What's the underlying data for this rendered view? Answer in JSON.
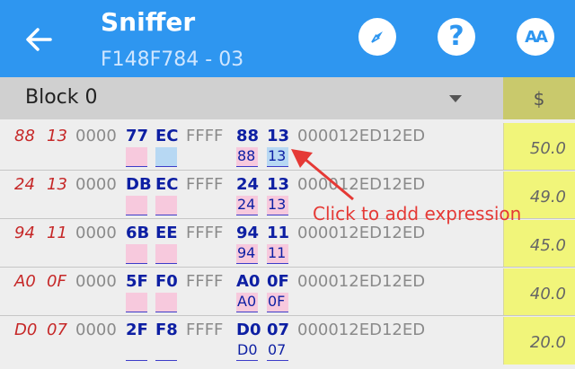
{
  "app": {
    "title": "Sniffer",
    "subtitle": "F148F784 - 03"
  },
  "block": {
    "label": "Block 0",
    "column_header": "$"
  },
  "rows": [
    {
      "raw": [
        "88",
        "13"
      ],
      "zeros": "0000",
      "b1": "77",
      "b2": "EC",
      "ffff": "FFFF",
      "b3": "88",
      "b4": "13",
      "tail": "000012ED12ED",
      "sub3": "88",
      "sub4": "13",
      "price": "50.0"
    },
    {
      "raw": [
        "24",
        "13"
      ],
      "zeros": "0000",
      "b1": "DB",
      "b2": "EC",
      "ffff": "FFFF",
      "b3": "24",
      "b4": "13",
      "tail": "000012ED12ED",
      "sub3": "24",
      "sub4": "13",
      "price": "49.0"
    },
    {
      "raw": [
        "94",
        "11"
      ],
      "zeros": "0000",
      "b1": "6B",
      "b2": "EE",
      "ffff": "FFFF",
      "b3": "94",
      "b4": "11",
      "tail": "000012ED12ED",
      "sub3": "94",
      "sub4": "11",
      "price": "45.0"
    },
    {
      "raw": [
        "A0",
        "0F"
      ],
      "zeros": "0000",
      "b1": "5F",
      "b2": "F0",
      "ffff": "FFFF",
      "b3": "A0",
      "b4": "0F",
      "tail": "000012ED12ED",
      "sub3": "A0",
      "sub4": "0F",
      "price": "40.0"
    },
    {
      "raw": [
        "D0",
        "07"
      ],
      "zeros": "0000",
      "b1": "2F",
      "b2": "F8",
      "ffff": "FFFF",
      "b3": "D0",
      "b4": "07",
      "tail": "000012ED12ED",
      "sub3": "D0",
      "sub4": "07",
      "price": "20.0"
    }
  ],
  "annotation": "Click to add expression",
  "icons": {
    "back": "arrow-left-icon",
    "compass": "compass-icon",
    "help": "help-icon",
    "text_size": "text-size-icon",
    "dropdown": "caret-down-icon"
  },
  "colors": {
    "app_bar": "#2e96f0",
    "price_column": "#f1f57a",
    "price_header": "#c9c96c",
    "raw_text": "#c62828",
    "hex_text": "#0d1fa3",
    "annotation": "#e53935"
  }
}
